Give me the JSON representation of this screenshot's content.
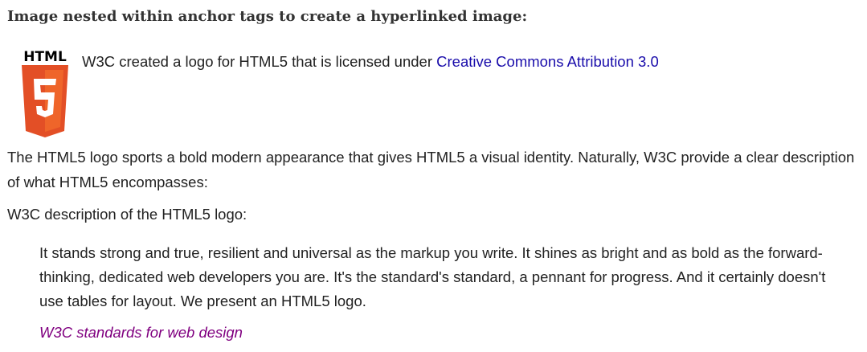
{
  "heading": "Image nested within anchor tags to create a hyperlinked image:",
  "logo": {
    "wordmark": "HTML",
    "digit": "5",
    "icon": "html5-shield-icon",
    "colors": {
      "shield_outer": "#e34f26",
      "shield_inner": "#ef652a",
      "wordmark": "#000000",
      "digit": "#ffffff"
    }
  },
  "caption": {
    "text": "W3C created a logo for HTML5 that is licensed under ",
    "link_label": "Creative Commons Attribution 3.0"
  },
  "paragraphs": [
    "The HTML5 logo sports a bold modern appearance that gives HTML5 a visual identity. Naturally, W3C provide a clear description of what HTML5 encompasses:",
    "W3C description of the HTML5 logo:"
  ],
  "blockquote": {
    "text": "It stands strong and true, resilient and universal as the markup you write. It shines as bright and as bold as the forward-thinking, dedicated web developers you are. It's the standard's standard, a pennant for progress. And it certainly doesn't use tables for layout. We present an HTML5 logo.",
    "cite": "W3C standards for web design"
  },
  "colors": {
    "link": "#1a0dab",
    "visited_link": "#800080",
    "text": "#222222"
  }
}
